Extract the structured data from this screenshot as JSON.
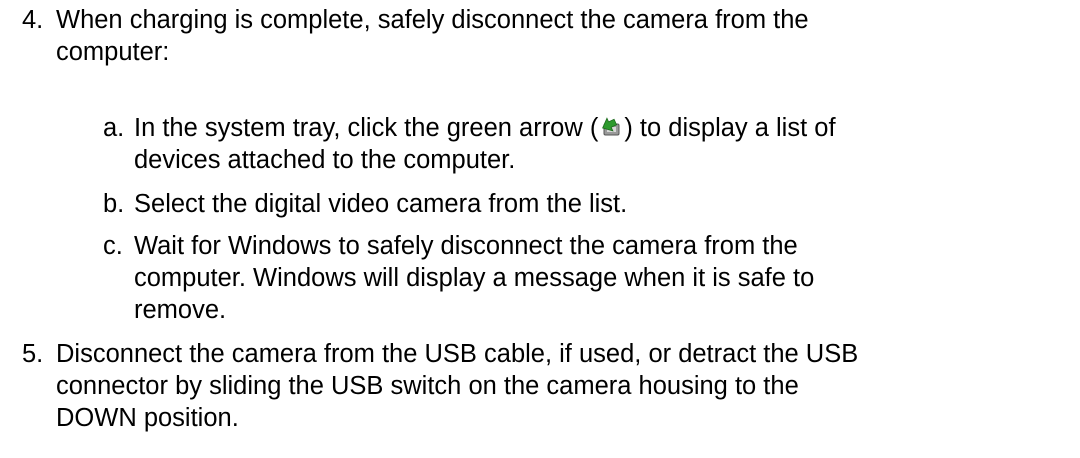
{
  "steps": [
    {
      "number": "4.",
      "lines": [
        "When charging is complete, safely disconnect the camera from the",
        "computer:"
      ],
      "substeps": [
        {
          "letter": "a.",
          "line1_before_icon": "In the system tray, click the green arrow (",
          "line1_after_icon": ") to display a list of",
          "line2": "devices attached to the computer.",
          "icon": "safely-remove-hardware-icon"
        },
        {
          "letter": "b.",
          "lines": [
            "Select the digital video camera from the list."
          ]
        },
        {
          "letter": "c.",
          "lines": [
            "Wait for Windows to safely disconnect the camera from the",
            "computer. Windows will display a message when it is safe to",
            "remove."
          ]
        }
      ]
    },
    {
      "number": "5.",
      "lines": [
        "Disconnect the camera from the USB cable, if used, or detract the USB",
        "connector by sliding the USB switch on the camera housing to the",
        "DOWN position."
      ]
    }
  ],
  "colors": {
    "text": "#000000",
    "background": "#ffffff",
    "icon_green": "#2e9a2e"
  }
}
